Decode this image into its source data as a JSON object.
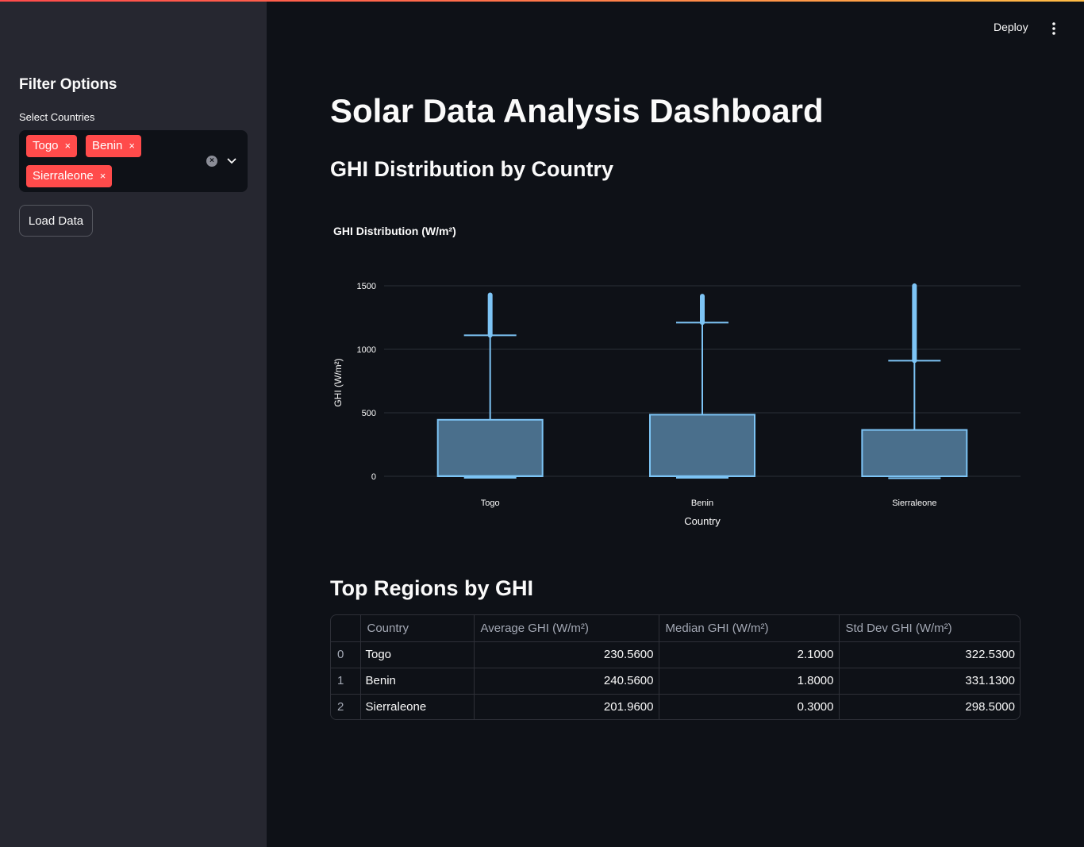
{
  "header": {
    "deploy_label": "Deploy",
    "menu_icon": "vertical-dots-icon"
  },
  "sidebar": {
    "title": "Filter Options",
    "select_label": "Select Countries",
    "selected": [
      "Togo",
      "Benin",
      "Sierraleone"
    ],
    "remove_icon": "×",
    "load_button": "Load Data"
  },
  "main": {
    "title": "Solar Data Analysis Dashboard",
    "chart_heading": "GHI Distribution by Country",
    "table_heading": "Top Regions by GHI"
  },
  "chart_data": {
    "type": "box",
    "title": "GHI Distribution (W/m²)",
    "xlabel": "Country",
    "ylabel": "GHI (W/m²)",
    "categories": [
      "Togo",
      "Benin",
      "Sierraleone"
    ],
    "yticks": [
      0,
      500,
      1000,
      1500
    ],
    "ylim": [
      -150,
      1570
    ],
    "grid": true,
    "boxes": [
      {
        "name": "Togo",
        "min": -12,
        "q1": 0,
        "median": 2.1,
        "q3": 445,
        "upper_fence": 1110,
        "max": 1428
      },
      {
        "name": "Benin",
        "min": -12,
        "q1": 0,
        "median": 1.8,
        "q3": 485,
        "upper_fence": 1210,
        "max": 1418
      },
      {
        "name": "Sierraleone",
        "min": -15,
        "q1": 0,
        "median": 0.3,
        "q3": 365,
        "upper_fence": 910,
        "max": 1500
      }
    ],
    "color": "#7dc4f5"
  },
  "table": {
    "columns": [
      "",
      "Country",
      "Average GHI (W/m²)",
      "Median GHI (W/m²)",
      "Std Dev GHI (W/m²)"
    ],
    "rows": [
      [
        "0",
        "Togo",
        "230.5600",
        "2.1000",
        "322.5300"
      ],
      [
        "1",
        "Benin",
        "240.5600",
        "1.8000",
        "331.1300"
      ],
      [
        "2",
        "Sierraleone",
        "201.9600",
        "0.3000",
        "298.5000"
      ]
    ]
  },
  "colors": {
    "accent": "#ff4b4b",
    "background": "#0e1117",
    "sidebar": "#262730",
    "box_fill": "#4a6f8c",
    "box_line": "#7dc4f5"
  }
}
